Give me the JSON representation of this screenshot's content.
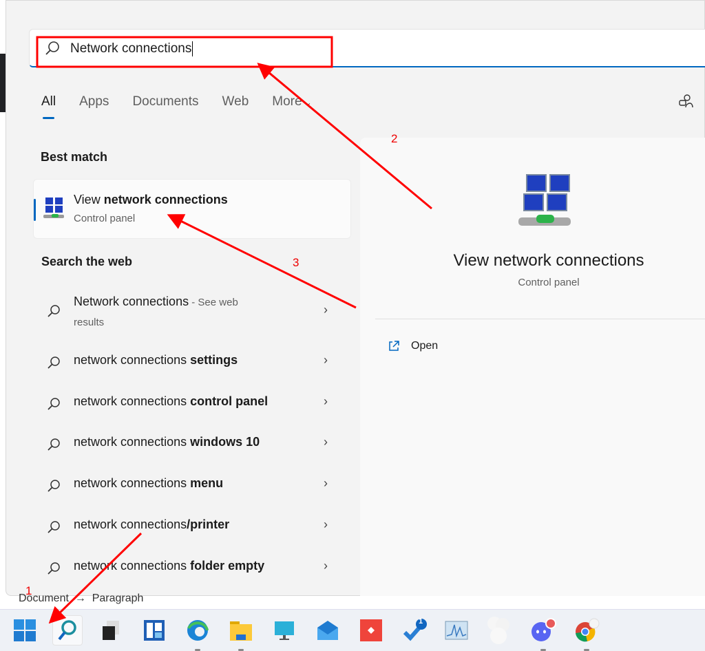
{
  "search": {
    "value": "Network connections"
  },
  "tabs": [
    {
      "label": "All"
    },
    {
      "label": "Apps"
    },
    {
      "label": "Documents"
    },
    {
      "label": "Web"
    },
    {
      "label": "More"
    }
  ],
  "best_match": {
    "heading": "Best match",
    "title_plain": "View ",
    "title_bold": "network connections",
    "subtitle": "Control panel"
  },
  "web": {
    "heading": "Search the web",
    "results": [
      {
        "plain": "Network connections",
        "bold": "",
        "suffix": " - See web",
        "suffix2": "results"
      },
      {
        "plain": "network connections ",
        "bold": "settings"
      },
      {
        "plain": "network connections ",
        "bold": "control panel"
      },
      {
        "plain": "network connections ",
        "bold": "windows 10"
      },
      {
        "plain": "network connections ",
        "bold": "menu"
      },
      {
        "plain": "network connections",
        "bold": "/printer"
      },
      {
        "plain": "network connections ",
        "bold": "folder empty"
      }
    ]
  },
  "preview": {
    "title": "View network connections",
    "subtitle": "Control panel",
    "open_label": "Open"
  },
  "breadcrumb": {
    "from": "Document",
    "arrow": "→",
    "to": "Paragraph"
  },
  "taskbar": {
    "items": [
      "start",
      "search",
      "task-view",
      "widgets",
      "edge",
      "file-explorer",
      "remote-desktop",
      "mail",
      "anydesk",
      "todo",
      "performance-monitor",
      "app-blurred",
      "discord",
      "chrome"
    ],
    "todo_badge": "1"
  },
  "annotations": {
    "labels": [
      "1",
      "2",
      "3"
    ],
    "color": "#ff0000"
  },
  "colors": {
    "accent": "#0067c0"
  }
}
